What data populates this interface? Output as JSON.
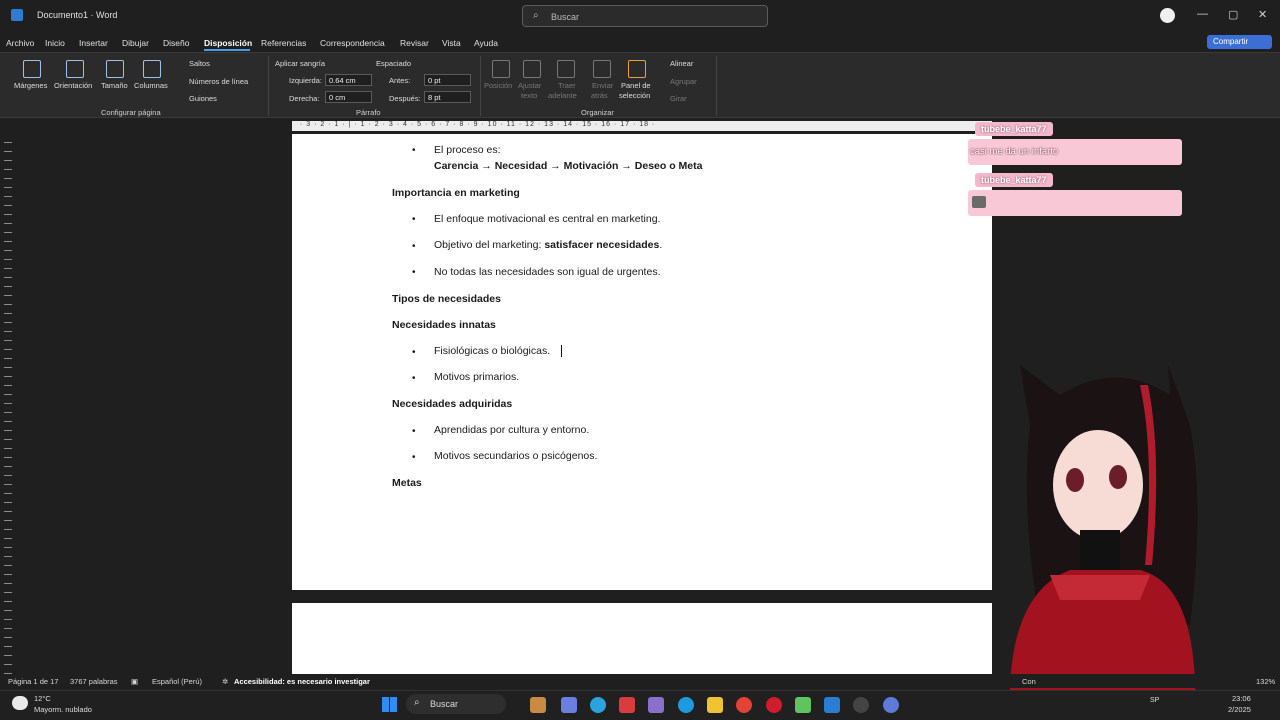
{
  "titlebar": {
    "document": "Documento1 · Word",
    "search_placeholder": "Buscar"
  },
  "menu": {
    "items": [
      "Archivo",
      "Inicio",
      "Insertar",
      "Dibujar",
      "Diseño",
      "Disposición",
      "Referencias",
      "Correspondencia",
      "Revisar",
      "Vista",
      "Ayuda"
    ],
    "active": "Disposición",
    "share": "Compartir"
  },
  "ribbon": {
    "page_setup": {
      "margins": "Márgenes",
      "orientation": "Orientación",
      "size": "Tamaño",
      "columns": "Columnas",
      "breaks": "Saltos",
      "line_numbers": "Números de línea",
      "hyphenation": "Guiones",
      "group": "Configurar página"
    },
    "paragraph": {
      "indent_title": "Aplicar sangría",
      "spacing_title": "Espaciado",
      "left_label": "Izquierda:",
      "left_value": "0.64 cm",
      "right_label": "Derecha:",
      "right_value": "0 cm",
      "before_label": "Antes:",
      "before_value": "0 pt",
      "after_label": "Después:",
      "after_value": "8 pt",
      "group": "Párrafo"
    },
    "arrange": {
      "position": "Posición",
      "wrap_line1": "Ajustar",
      "wrap_line2": "texto",
      "forward_line1": "Traer",
      "forward_line2": "adelante",
      "backward_line1": "Enviar",
      "backward_line2": "atrás",
      "selection_line1": "Panel de",
      "selection_line2": "selección",
      "align": "Alinear",
      "group_btn": "Agrupar",
      "rotate": "Girar",
      "group": "Organizar"
    }
  },
  "ruler": {
    "marks": "· 3 · 2 · 1 · | · 1 · 2 · 3 · 4 · 5 · 6 · 7 · 8 · 9 · 10 · 11 · 12 · 13 · 14 · 15 · 16 · 17 · 18 ·"
  },
  "document": {
    "line1": "El proceso es:",
    "chain": [
      "Carencia",
      "Necesidad",
      "Motivación",
      "Deseo o Meta"
    ],
    "arrow": "→",
    "h_marketing": "Importancia en marketing",
    "m1": "El enfoque motivacional es central en marketing.",
    "m2_prefix": "Objetivo del marketing: ",
    "m2_bold": "satisfacer necesidades",
    "m2_suffix": ".",
    "m3": "No todas las necesidades son igual de urgentes.",
    "h_tipos": "Tipos de necesidades",
    "h_innatas": "Necesidades innatas",
    "i1": "Fisiológicas o biológicas.",
    "i2": "Motivos primarios.",
    "h_adquiridas": "Necesidades adquiridas",
    "a1": "Aprendidas por cultura y entorno.",
    "a2": "Motivos secundarios o psicógenos.",
    "h_metas": "Metas",
    "bullet": "•"
  },
  "chat": [
    {
      "user": "tubebe_katta77",
      "message": "casi me da un infarto"
    },
    {
      "user": "tubebe_katta77",
      "message": ""
    }
  ],
  "statusbar": {
    "page": "Página 1 de 17",
    "words": "3767 palabras",
    "language": "Español (Perú)",
    "accessibility": "Accesibilidad: es necesario investigar",
    "zoom": "132%",
    "focus": "Con"
  },
  "taskbar": {
    "temp": "12°C",
    "weather": "Mayorm. nublado",
    "search": "Buscar",
    "time": "23:06",
    "date": "2/2025",
    "lang": "SP"
  },
  "colors": {
    "accent": "#4a9be8",
    "chat_pink": "#f3b8cc",
    "share": "#3b6fd6"
  }
}
